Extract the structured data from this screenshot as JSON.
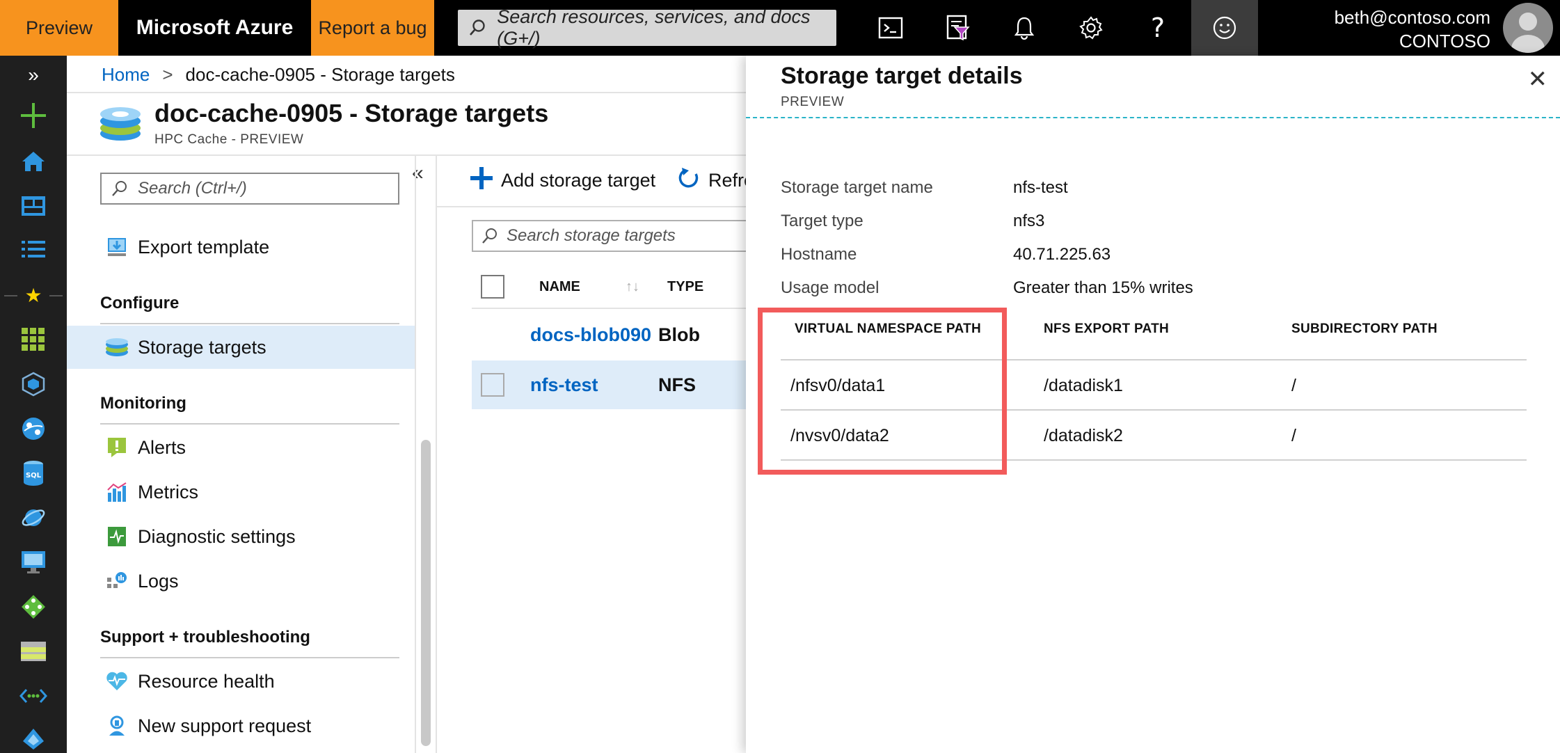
{
  "topbar": {
    "preview_label": "Preview",
    "brand": "Microsoft Azure",
    "bug_label": "Report a bug",
    "search_placeholder": "Search resources, services, and docs (G+/)",
    "icons": [
      "cloud-shell-icon",
      "directory-filter-icon",
      "notifications-icon",
      "settings-icon",
      "help-icon",
      "feedback-icon"
    ],
    "user_email": "beth@contoso.com",
    "user_org": "CONTOSO"
  },
  "breadcrumb": {
    "home": "Home",
    "separator": ">",
    "current": "doc-cache-0905 - Storage targets"
  },
  "header": {
    "title": "doc-cache-0905 - Storage targets",
    "subtitle": "HPC Cache - PREVIEW"
  },
  "resource_menu": {
    "search_placeholder": "Search (Ctrl+/)",
    "collapse_glyph": "«",
    "export_template": "Export template",
    "groups": {
      "configure": "Configure",
      "monitoring": "Monitoring",
      "support": "Support + troubleshooting"
    },
    "items": {
      "storage_targets": "Storage targets",
      "alerts": "Alerts",
      "metrics": "Metrics",
      "diagnostic_settings": "Diagnostic settings",
      "logs": "Logs",
      "resource_health": "Resource health",
      "new_support_request": "New support request"
    }
  },
  "main": {
    "add_label": "Add storage target",
    "refresh_label": "Refre",
    "search_placeholder": "Search storage targets",
    "columns": {
      "name": "NAME",
      "type": "TYPE"
    },
    "rows": [
      {
        "name": "docs-blob090",
        "type": "Blob"
      },
      {
        "name": "nfs-test",
        "type": "NFS"
      }
    ]
  },
  "details": {
    "title": "Storage target details",
    "subtitle": "PREVIEW",
    "close_glyph": "✕",
    "props": {
      "name_label": "Storage target name",
      "name_value": "nfs-test",
      "type_label": "Target type",
      "type_value": "nfs3",
      "host_label": "Hostname",
      "host_value": "40.71.225.63",
      "usage_label": "Usage model",
      "usage_value": "Greater than 15% writes"
    },
    "namespace": {
      "headers": {
        "virtual": "VIRTUAL NAMESPACE PATH",
        "export": "NFS EXPORT PATH",
        "subdir": "SUBDIRECTORY PATH"
      },
      "rows": [
        {
          "virtual": "/nfsv0/data1",
          "export": "/datadisk1",
          "subdir": "/"
        },
        {
          "virtual": "/nvsv0/data2",
          "export": "/datadisk2",
          "subdir": "/"
        }
      ]
    }
  },
  "colors": {
    "accent_orange": "#f7931e",
    "link_blue": "#0064c1",
    "selected_bg": "#deecf9",
    "highlight_red": "#f25b5b",
    "dash_teal": "#2ab3c8"
  }
}
